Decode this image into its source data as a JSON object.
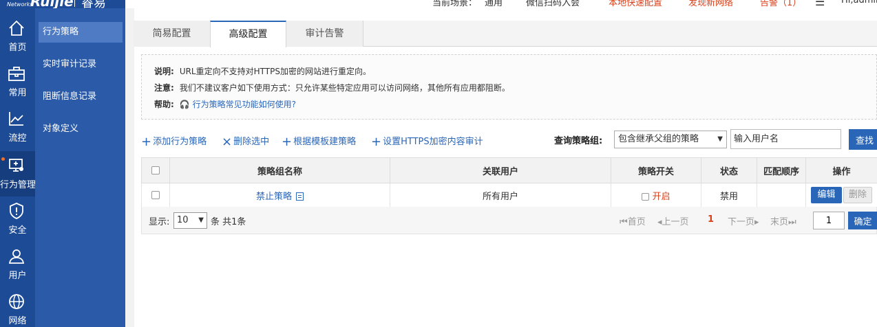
{
  "logo": {
    "brand": "Ruijie",
    "sub": "Networks",
    "product": "睿易"
  },
  "header": {
    "scene_label": "当前场景：",
    "scene_value": "通用",
    "frag_scene": "微信扫码入会",
    "frag_config": "本地快速配置",
    "frag_forum": "发现新网络",
    "frag_alarm": "告警（1）",
    "frag_user": "Hi,admin"
  },
  "rail": {
    "items": [
      {
        "label": "首页",
        "icon": "home-icon"
      },
      {
        "label": "常用",
        "icon": "toolbox-icon"
      },
      {
        "label": "流控",
        "icon": "chart-icon"
      },
      {
        "label": "行为管理",
        "icon": "monitor-icon"
      },
      {
        "label": "安全",
        "icon": "shield-icon"
      },
      {
        "label": "用户",
        "icon": "user-icon"
      },
      {
        "label": "网络",
        "icon": "globe-icon"
      }
    ]
  },
  "sidebar": {
    "items": [
      {
        "label": "行为策略"
      },
      {
        "label": "实时审计记录"
      },
      {
        "label": "阻断信息记录"
      },
      {
        "label": "对象定义"
      }
    ]
  },
  "tabs": [
    {
      "label": "简易配置"
    },
    {
      "label": "高级配置"
    },
    {
      "label": "审计告警"
    }
  ],
  "info": {
    "note_label": "说明:",
    "note_text": "URL重定向不支持对HTTPS加密的网站进行重定向。",
    "warn_label": "注意:",
    "warn_text": "我们不建议客户如下使用方式：只允许某些特定应用可以访问网络，其他所有应用都阻断。",
    "help_label": "帮助:",
    "help_text": "行为策略常见功能如何使用?"
  },
  "toolbar": {
    "add": "添加行为策略",
    "delete": "删除选中",
    "template": "根据模板建策略",
    "https": "设置HTTPS加密内容审计",
    "query_label": "查询策略组:",
    "query_select": "包含继承父组的策略",
    "query_placeholder": "输入用户名",
    "search": "查找"
  },
  "table": {
    "headers": {
      "name": "策略组名称",
      "users": "关联用户",
      "switch": "策略开关",
      "status": "状态",
      "order": "匹配顺序",
      "ops": "操作"
    },
    "rows": [
      {
        "name": "禁止策略",
        "users": "所有用户",
        "switch": "开启",
        "status": "禁用",
        "order": "",
        "edit": "编辑",
        "del": "删除"
      }
    ]
  },
  "pager": {
    "show": "显示:",
    "size": "10",
    "summary": "条 共1条",
    "first": "首页",
    "prev": "上一页",
    "current": "1",
    "next": "下一页",
    "last": "末页",
    "goto_value": "1",
    "goto": "确定"
  },
  "colors": {
    "rail": "#1d4b96",
    "sidebar": "#2a5aa8",
    "accent": "#2a66b8",
    "red": "#d9401a"
  }
}
